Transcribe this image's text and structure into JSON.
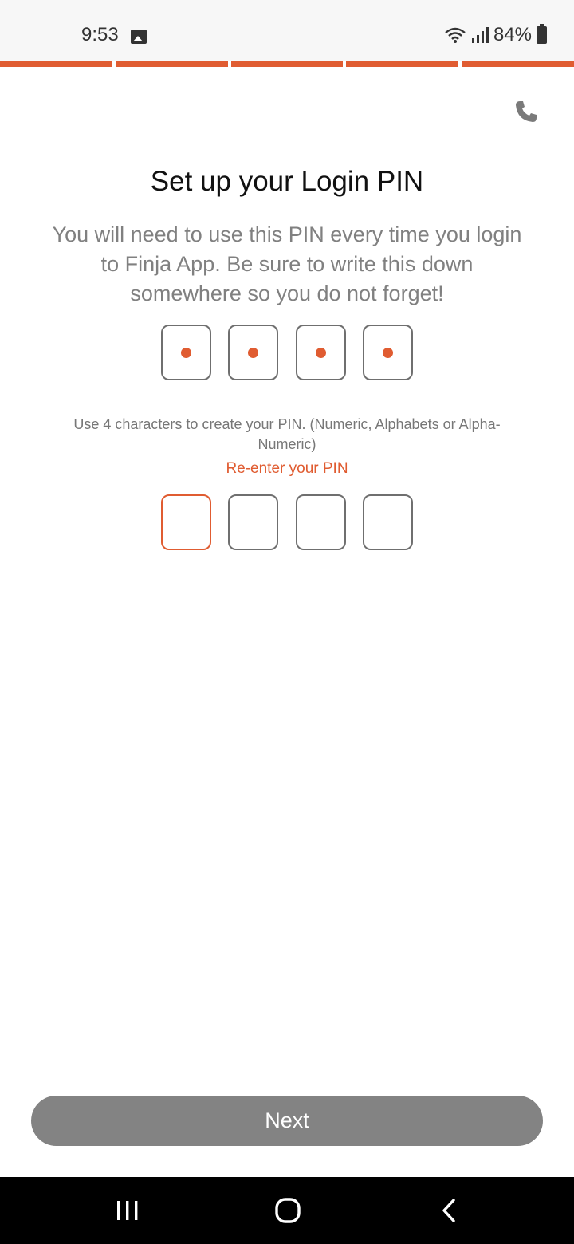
{
  "status_bar": {
    "time": "9:53",
    "battery_text": "84%",
    "icons": [
      "gallery-icon",
      "wifi-icon",
      "signal-icon",
      "battery-icon"
    ]
  },
  "progress": {
    "segments": 5,
    "completed": 5,
    "color": "#e05c31"
  },
  "header": {
    "call_icon": "phone-icon"
  },
  "main": {
    "title": "Set up your Login PIN",
    "subtitle": "You will need to use this PIN every time you login to Finja App. Be sure to write this down somewhere so you do not forget!",
    "pin_hint": "Use 4 characters to create your PIN. (Numeric, Alphabets or Alpha-Numeric)",
    "reenter_label": "Re-enter your PIN",
    "pin_entered_count": 4,
    "reenter_entered_count": 0
  },
  "footer": {
    "next_label": "Next"
  },
  "colors": {
    "accent": "#e05c31",
    "button_disabled": "#838383",
    "text_muted": "#808080"
  },
  "nav": {
    "icons": [
      "recent-apps-icon",
      "home-icon",
      "back-icon"
    ]
  }
}
